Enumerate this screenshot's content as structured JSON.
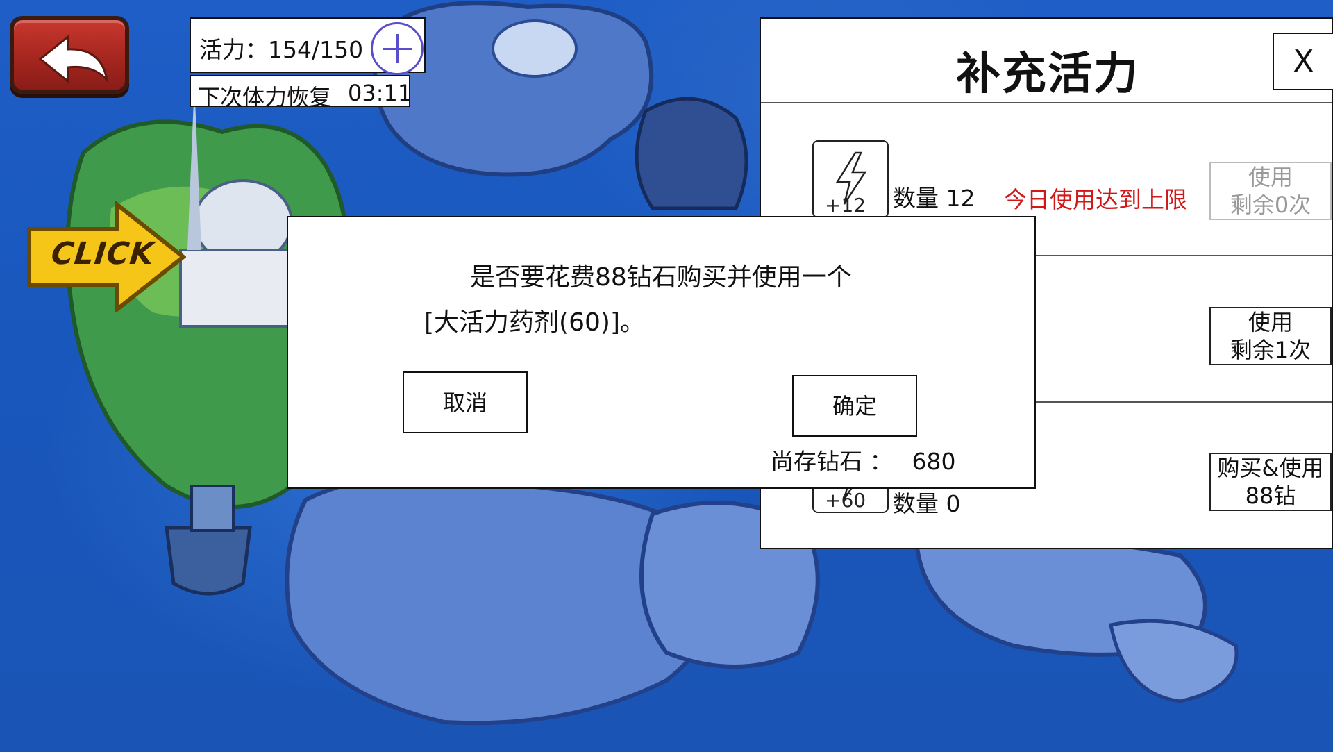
{
  "energy": {
    "label": "活力：",
    "value": "154/150"
  },
  "recover": {
    "label": "下次体力恢复",
    "time": "03:11"
  },
  "map": {
    "click_label": "CLICK"
  },
  "panel": {
    "title": "补充活力",
    "close_label": "X",
    "rows": [
      {
        "icon_amount": "+12",
        "qty": "数量 12",
        "limit_msg": "今日使用达到上限",
        "button_line1": "使用",
        "button_line2": "剩余0次"
      },
      {
        "button_line1": "使用",
        "button_line2": "剩余1次"
      },
      {
        "icon_amount": "+60",
        "qty": "数量 0",
        "button_line1": "购买&使用",
        "button_line2": "88钻"
      }
    ]
  },
  "dialog": {
    "message_line1": "是否要花费88钻石购买并使用一个",
    "message_line2": "[大活力药剂(60)]。",
    "cancel_label": "取消",
    "confirm_label": "确定",
    "diamond_label": "尚存钻石 ：",
    "diamond_value": "680"
  },
  "colors": {
    "ocean": "#1a58bf",
    "limit_text": "#d01818",
    "plus_circle": "#5a4fc9",
    "back_button": "#b52a22",
    "click_arrow": "#f5c518"
  }
}
